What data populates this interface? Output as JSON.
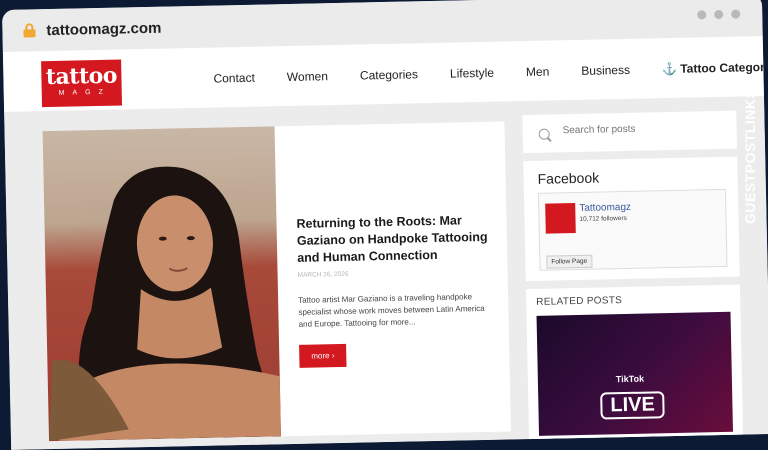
{
  "browser": {
    "url": "tattoomagz.com"
  },
  "logo": {
    "main": "tattoo",
    "sub": "MAGZ"
  },
  "nav": {
    "items": [
      "Contact",
      "Women",
      "Categories",
      "Lifestyle",
      "Men",
      "Business"
    ],
    "last": "⚓ Tattoo Categories"
  },
  "feature": {
    "title": "Returning to the Roots: Mar Gaziano on Handpoke Tattooing and Human Connection",
    "date": "MARCH 26, 2026",
    "excerpt": "Tattoo artist Mar Gaziano is a traveling handpoke specialist whose work moves between Latin America and Europe. Tattooing for more...",
    "more_label": "more ›"
  },
  "sidebar": {
    "search_placeholder": "Search for posts",
    "facebook_title": "Facebook",
    "fb_page_name": "Tattoomagz",
    "fb_followers": "10,712 followers",
    "fb_follow_label": "Follow Page",
    "related_title": "RELATED POSTS",
    "related_tiktok": "TikTok",
    "related_live": "LIVE"
  },
  "brand": {
    "text": "GUESTPOSTLINKS"
  },
  "colors": {
    "accent": "#d3181f",
    "facebook": "#3b5998"
  }
}
